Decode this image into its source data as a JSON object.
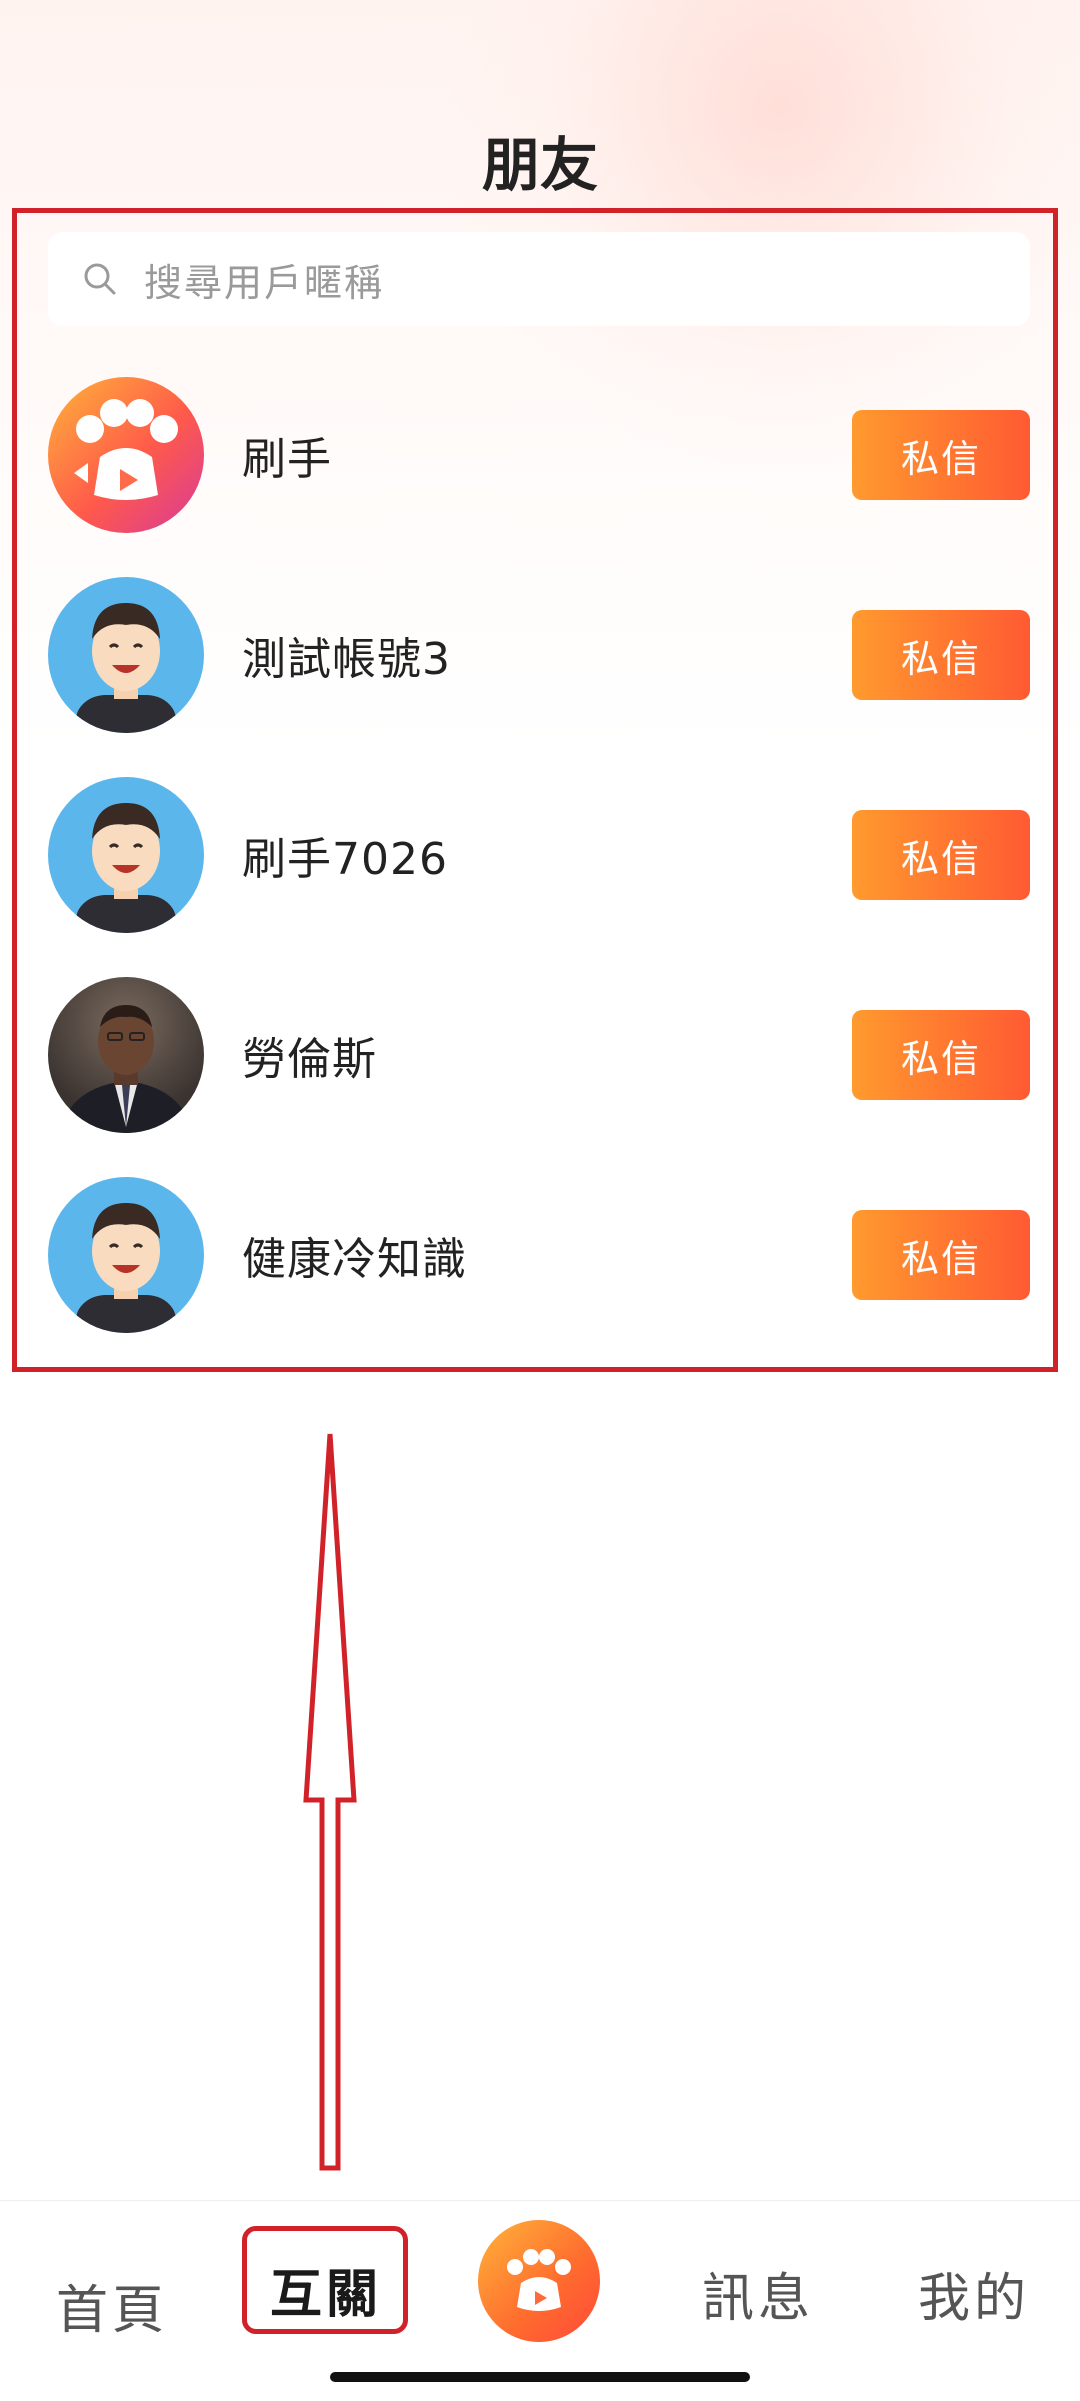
{
  "header": {
    "title": "朋友"
  },
  "search": {
    "placeholder": "搜尋用戶暱稱",
    "icon": "search-icon"
  },
  "friends": [
    {
      "name": "刷手",
      "avatar": "app-logo-avatar",
      "action": "私信"
    },
    {
      "name": "測試帳號3",
      "avatar": "cartoon-man-avatar",
      "action": "私信"
    },
    {
      "name": "刷手7026",
      "avatar": "cartoon-man-avatar",
      "action": "私信"
    },
    {
      "name": "勞倫斯",
      "avatar": "photo-man-in-suit-avatar",
      "action": "私信"
    },
    {
      "name": "健康冷知識",
      "avatar": "cartoon-man-avatar",
      "action": "私信"
    }
  ],
  "tabbar": {
    "items": [
      {
        "label": "首頁"
      },
      {
        "label": "互關",
        "active": true
      },
      {
        "label": "",
        "icon": "paw-camera-icon"
      },
      {
        "label": "訊息"
      },
      {
        "label": "我的"
      }
    ]
  },
  "colors": {
    "accent_gradient_start": "#ff9a2e",
    "accent_gradient_end": "#ff5a32",
    "annotation_red": "#d1222a"
  }
}
